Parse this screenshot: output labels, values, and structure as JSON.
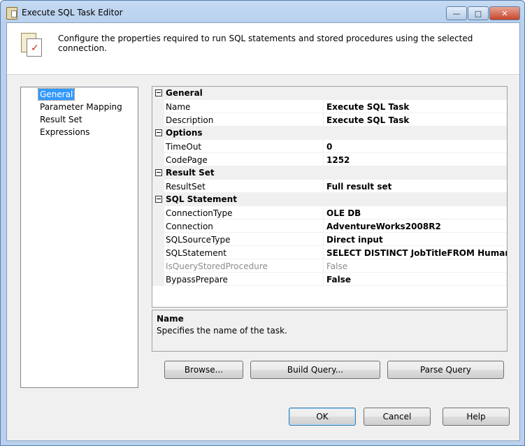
{
  "window": {
    "title": "Execute SQL Task Editor"
  },
  "caption": {
    "minimize": "—",
    "maximize": "□",
    "close": "✕"
  },
  "header": {
    "description": "Configure the properties required to run SQL statements and stored procedures using the selected connection."
  },
  "nav": {
    "items": [
      {
        "label": "General",
        "selected": true
      },
      {
        "label": "Parameter Mapping"
      },
      {
        "label": "Result Set"
      },
      {
        "label": "Expressions"
      }
    ]
  },
  "grid": {
    "categories": [
      {
        "label": "General",
        "props": [
          {
            "name": "Name",
            "value": "Execute SQL Task"
          },
          {
            "name": "Description",
            "value": "Execute SQL Task"
          }
        ]
      },
      {
        "label": "Options",
        "props": [
          {
            "name": "TimeOut",
            "value": "0"
          },
          {
            "name": "CodePage",
            "value": "1252"
          }
        ]
      },
      {
        "label": "Result Set",
        "props": [
          {
            "name": "ResultSet",
            "value": "Full result set"
          }
        ]
      },
      {
        "label": "SQL Statement",
        "props": [
          {
            "name": "ConnectionType",
            "value": "OLE DB"
          },
          {
            "name": "Connection",
            "value": "AdventureWorks2008R2"
          },
          {
            "name": "SQLSourceType",
            "value": "Direct input"
          },
          {
            "name": "SQLStatement",
            "value": "SELECT DISTINCT JobTitleFROM HumanResour"
          },
          {
            "name": "IsQueryStoredProcedure",
            "value": "False",
            "disabled": true
          },
          {
            "name": "BypassPrepare",
            "value": "False"
          }
        ]
      }
    ]
  },
  "description_panel": {
    "title": "Name",
    "text": "Specifies the name of the task."
  },
  "buttons": {
    "browse": "Browse...",
    "build_query": "Build Query...",
    "parse_query": "Parse Query",
    "ok": "OK",
    "cancel": "Cancel",
    "help": "Help"
  }
}
